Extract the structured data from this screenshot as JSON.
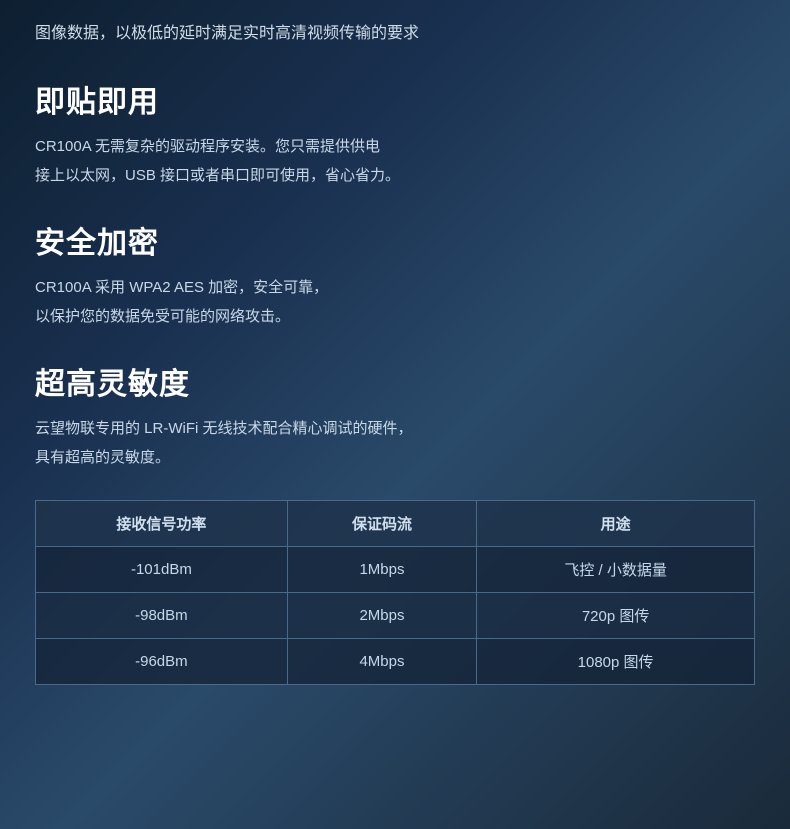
{
  "intro": {
    "text": "图像数据，以极低的延时满足实时高清视频传输的要求"
  },
  "sections": [
    {
      "id": "instant-use",
      "title": "即贴即用",
      "body_line1": "CR100A 无需复杂的驱动程序安装。您只需提供供电",
      "body_line2": "接上以太网，USB 接口或者串口即可使用，省心省力。"
    },
    {
      "id": "security",
      "title": "安全加密",
      "body_line1": "CR100A 采用 WPA2 AES 加密，安全可靠，",
      "body_line2": "以保护您的数据免受可能的网络攻击。"
    },
    {
      "id": "sensitivity",
      "title": "超高灵敏度",
      "body_line1": "云望物联专用的 LR-WiFi 无线技术配合精心调试的硬件，",
      "body_line2": "具有超高的灵敏度。"
    }
  ],
  "table": {
    "headers": [
      "接收信号功率",
      "保证码流",
      "用途"
    ],
    "rows": [
      {
        "-101dBm": "-101dBm",
        "1Mbps": "1Mbps",
        "飞控 / 小数据量": "飞控 / 小数据量"
      },
      {
        "-98dBm": "-98dBm",
        "2Mbps": "2Mbps",
        "720p 图传": "720p 图传"
      },
      {
        "-96dBm": "-96dBm",
        "4Mbps": "4Mbps",
        "1080p 图传": "1080p 图传"
      }
    ],
    "rows_data": [
      [
        "-101dBm",
        "1Mbps",
        "飞控 / 小数据量"
      ],
      [
        "-98dBm",
        "2Mbps",
        "720p 图传"
      ],
      [
        "-96dBm",
        "4Mbps",
        "1080p 图传"
      ]
    ]
  }
}
